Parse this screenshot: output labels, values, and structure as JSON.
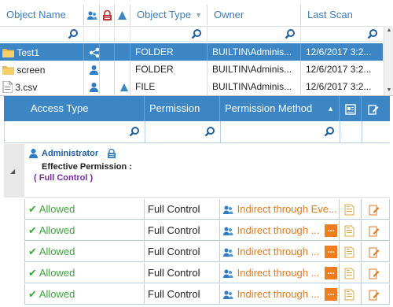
{
  "objects_table": {
    "headers": {
      "name": "Object Name",
      "type": "Object Type",
      "owner": "Owner",
      "last_scan": "Last Scan"
    },
    "rows": [
      {
        "name": "Test1",
        "type": "FOLDER",
        "owner": "BUILTIN\\Adminis...",
        "last_scan": "12/6/2017 3:2..."
      },
      {
        "name": "screen",
        "type": "FOLDER",
        "owner": "BUILTIN\\Adminis...",
        "last_scan": "12/6/2017 3:2..."
      },
      {
        "name": "3.csv",
        "type": "FILE",
        "owner": "BUILTIN\\Adminis...",
        "last_scan": "12/6/2017 3:2..."
      }
    ]
  },
  "permissions_table": {
    "headers": {
      "access_type": "Access Type",
      "permission": "Permission",
      "method": "Permission Method"
    },
    "group": {
      "name": "Administrator",
      "effective_label": "Effective Permission :",
      "effective_value": "( Full Control )"
    },
    "rows": [
      {
        "access": "Allowed",
        "permission": "Full Control",
        "method": "Indirect through Eve..."
      },
      {
        "access": "Allowed",
        "permission": "Full Control",
        "method": "Indirect through ..."
      },
      {
        "access": "Allowed",
        "permission": "Full Control",
        "method": "Indirect through ..."
      },
      {
        "access": "Allowed",
        "permission": "Full Control",
        "method": "Indirect through ..."
      },
      {
        "access": "Allowed",
        "permission": "Full Control",
        "method": "Indirect through ..."
      }
    ],
    "more_button": "..."
  },
  "colors": {
    "accent": "#3d86c6",
    "allowed": "#3aa83a",
    "method": "#e07b21",
    "effective": "#7a2aa8"
  }
}
